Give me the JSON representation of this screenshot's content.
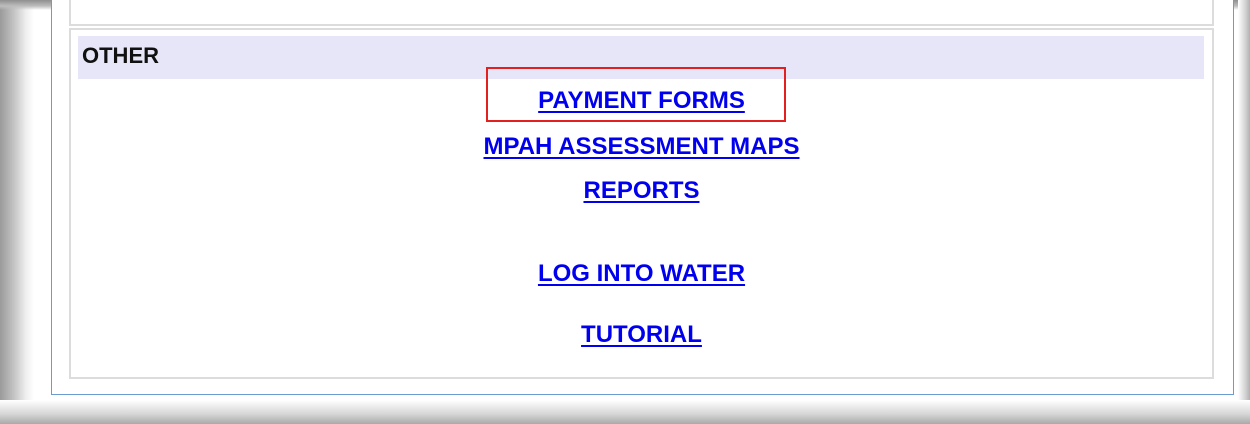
{
  "section": {
    "title": "OTHER"
  },
  "links": {
    "payment_forms": "PAYMENT FORMS",
    "assessment_maps": "MPAH ASSESSMENT MAPS",
    "reports": "REPORTS",
    "log_into_water": "LOG INTO WATER",
    "tutorial": "TUTORIAL"
  },
  "colors": {
    "link": "#0000ee",
    "header_bg": "#e6e6f8",
    "highlight": "#e32020",
    "frame": "#6b9bd1"
  }
}
